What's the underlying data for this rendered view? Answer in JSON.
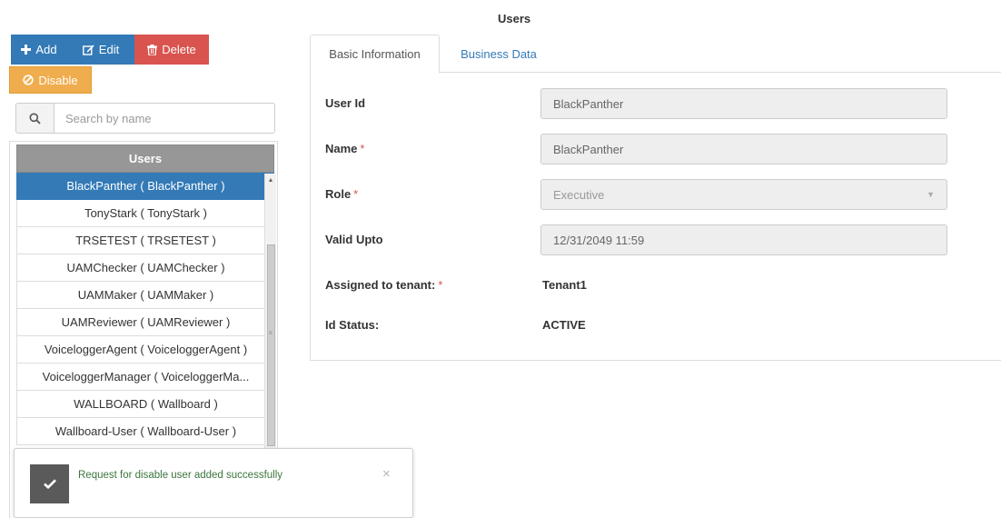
{
  "page": {
    "title": "Users"
  },
  "toolbar": {
    "add_label": "Add",
    "edit_label": "Edit",
    "delete_label": "Delete",
    "disable_label": "Disable"
  },
  "search": {
    "placeholder": "Search by name",
    "value": ""
  },
  "user_list": {
    "header": "Users",
    "items": [
      "BlackPanther ( BlackPanther )",
      "TonyStark ( TonyStark )",
      "TRSETEST ( TRSETEST )",
      "UAMChecker ( UAMChecker )",
      "UAMMaker ( UAMMaker )",
      "UAMReviewer ( UAMReviewer )",
      "VoiceloggerAgent ( VoiceloggerAgent )",
      "VoiceloggerManager ( VoiceloggerMa...",
      "WALLBOARD ( Wallboard )",
      "Wallboard-User ( Wallboard-User )"
    ],
    "selected_index": 0
  },
  "toast": {
    "message": "Request for disable user added successfully",
    "close": "×"
  },
  "tabs": [
    {
      "label": "Basic Information",
      "active": true
    },
    {
      "label": "Business Data",
      "active": false
    }
  ],
  "form": {
    "user_id": {
      "label": "User Id",
      "value": "BlackPanther"
    },
    "name": {
      "label": "Name",
      "value": "BlackPanther",
      "required_mark": "*"
    },
    "role": {
      "label": "Role",
      "value": "Executive",
      "required_mark": "*"
    },
    "valid_upto": {
      "label": "Valid Upto",
      "value": "12/31/2049 11:59"
    },
    "tenant": {
      "label": "Assigned to tenant:",
      "value": "Tenant1",
      "required_mark": "*"
    },
    "id_status": {
      "label": "Id Status:",
      "value": "ACTIVE"
    }
  },
  "colors": {
    "primary": "#337ab7",
    "danger": "#d9534f",
    "warning": "#f0ad4e",
    "list_header": "#979797",
    "toast_text": "#3c763d"
  },
  "icons": {
    "add": "plus-icon",
    "edit": "edit-icon",
    "delete": "trash-icon",
    "disable": "ban-icon",
    "search": "search-icon",
    "toast": "check-icon",
    "close": "close-icon",
    "role_select": "caret-down-icon"
  }
}
